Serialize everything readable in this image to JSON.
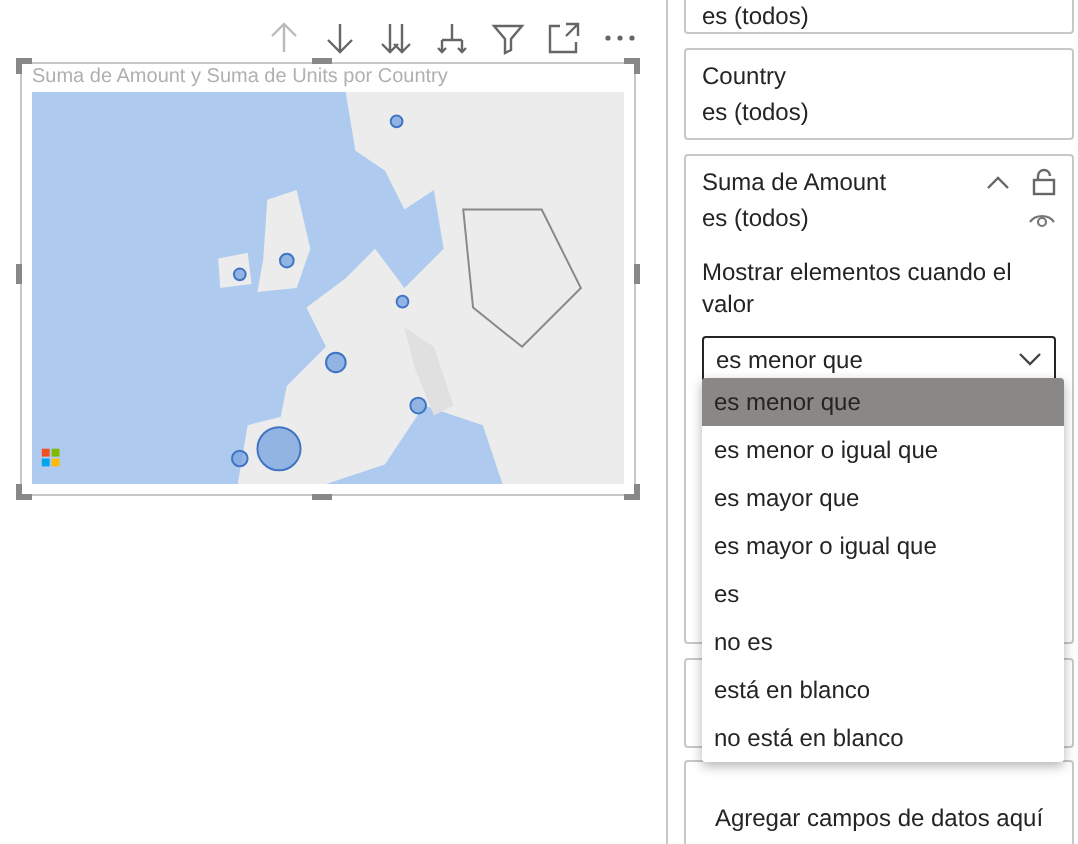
{
  "visual": {
    "title": "Suma de Amount y Suma de Units por Country",
    "toolbar": [
      {
        "kind": "up"
      },
      {
        "kind": "down"
      },
      {
        "kind": "down-all"
      },
      {
        "kind": "expand"
      },
      {
        "kind": "filter"
      },
      {
        "kind": "focus"
      },
      {
        "kind": "more"
      }
    ]
  },
  "filters": [
    {
      "value": "es (todos)"
    },
    {
      "field": "Country",
      "value": "es (todos)"
    }
  ],
  "active_filter": {
    "field": "Suma de Amount",
    "value": "es (todos)",
    "expanded": true,
    "condition_label": "Mostrar elementos cuando el valor",
    "condition": "es menor que"
  },
  "dropdown": [
    {
      "label": "es menor que",
      "selected": true
    },
    {
      "label": "es menor o igual que",
      "selected": false
    },
    {
      "label": "es mayor que",
      "selected": false
    },
    {
      "label": "es mayor o igual que",
      "selected": false
    },
    {
      "label": "es",
      "selected": false
    },
    {
      "label": "no es",
      "selected": false
    },
    {
      "label": "está en blanco",
      "selected": false
    },
    {
      "label": "no está en blanco",
      "selected": false
    }
  ],
  "add_fields": "Agregar campos de datos aquí"
}
